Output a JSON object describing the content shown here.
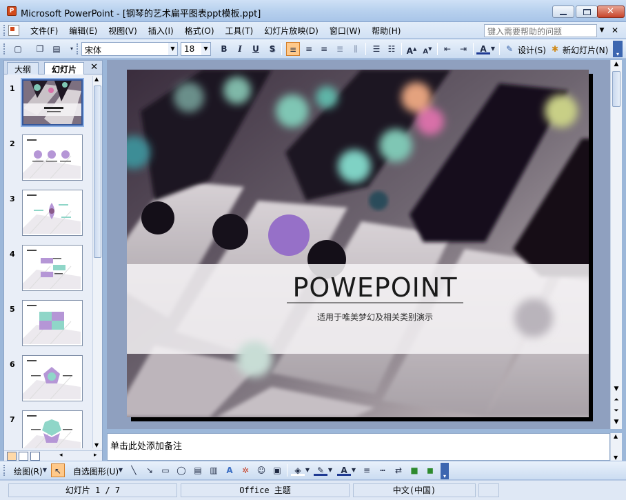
{
  "window": {
    "title": "Microsoft PowerPoint - [钢琴的艺术扁平图表ppt模板.ppt]",
    "app_icon": "powerpoint-icon"
  },
  "menubar": {
    "items": [
      "文件(F)",
      "编辑(E)",
      "视图(V)",
      "插入(I)",
      "格式(O)",
      "工具(T)",
      "幻灯片放映(D)",
      "窗口(W)",
      "帮助(H)"
    ],
    "help_placeholder": "键入需要帮助的问题"
  },
  "toolbar": {
    "font_name": "宋体",
    "font_size": "18",
    "bold": "B",
    "italic": "I",
    "underline": "U",
    "shadow": "S",
    "font_color_letter": "A",
    "design_label": "设计(S)",
    "new_slide_label": "新幻灯片(N)"
  },
  "leftpane": {
    "tab_outline": "大纲",
    "tab_slides": "幻灯片",
    "slide_numbers": [
      "1",
      "2",
      "3",
      "4",
      "5",
      "6",
      "7"
    ],
    "selected_slide": 1
  },
  "slide": {
    "title": "POWEPOINT",
    "subtitle": "适用于唯美梦幻及相关类别演示"
  },
  "notes": {
    "placeholder": "单击此处添加备注"
  },
  "drawbar": {
    "draw_label": "绘图(R)",
    "autoshapes_label": "自选图形(U)"
  },
  "statusbar": {
    "slide_pos": "幻灯片 1 / 7",
    "theme": "Office 主题",
    "language": "中文(中国)"
  },
  "colors": {
    "accent_purple": "#b596d6",
    "accent_mint": "#8fd6c8",
    "selection": "#35589c"
  }
}
